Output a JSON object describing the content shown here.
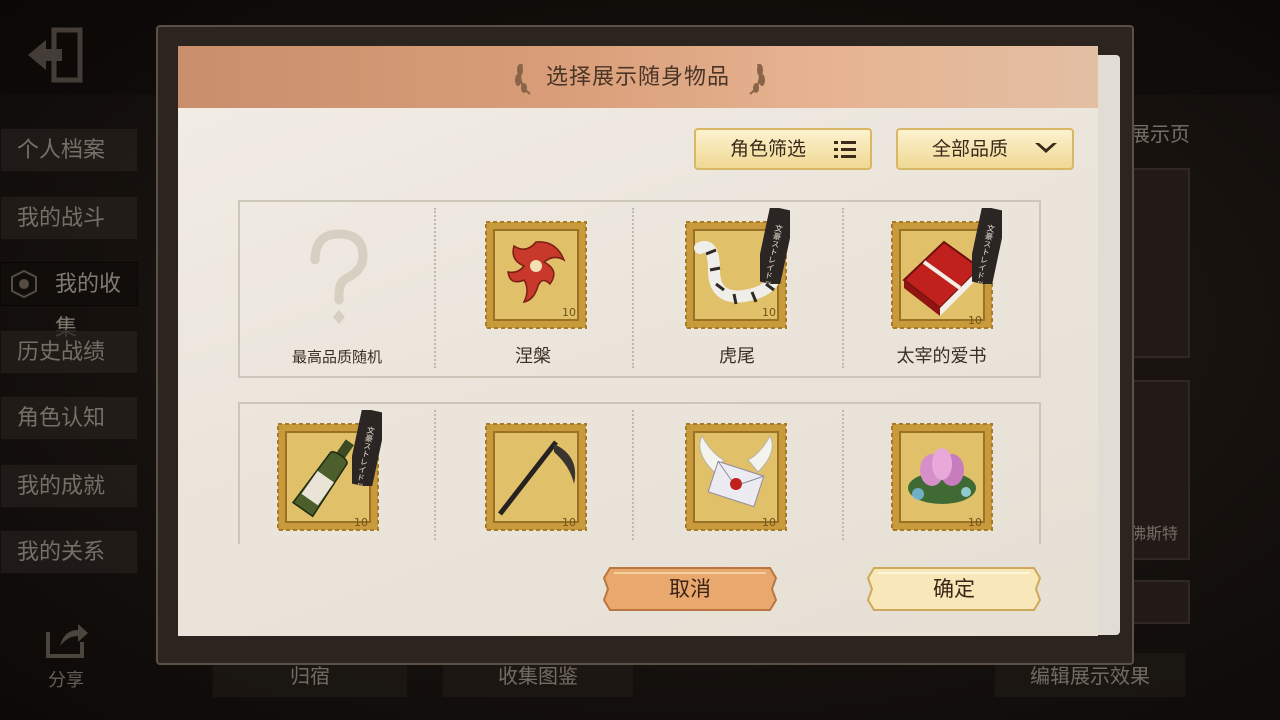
{
  "background": {
    "side_tabs": [
      "个人档案",
      "我的战斗",
      "我的收集",
      "历史战绩",
      "角色认知",
      "我的成就",
      "我的关系"
    ],
    "active_tab": "我的收集",
    "share_label": "分享",
    "bottom_left_label": "归宿",
    "bottom_mid_label": "收集图鉴",
    "bottom_right_label": "编辑展示效果",
    "right_title": "展示页",
    "right_labels": [
      "佛斯特"
    ]
  },
  "modal": {
    "title": "选择展示随身物品",
    "filter_role_label": "角色筛选",
    "filter_quality_label": "全部品质",
    "items": [
      {
        "label": "最高品质随机",
        "icon": "question-mark-icon"
      },
      {
        "label": "涅槃",
        "icon": "phoenix-icon"
      },
      {
        "label": "虎尾",
        "icon": "tiger-tail-icon"
      },
      {
        "label": "太宰的爱书",
        "icon": "red-book-icon"
      },
      {
        "label": "",
        "icon": "wine-bottle-icon"
      },
      {
        "label": "",
        "icon": "scythe-icon"
      },
      {
        "label": "",
        "icon": "winged-letter-icon"
      },
      {
        "label": "",
        "icon": "lotus-icon"
      }
    ],
    "stamp_value": "10",
    "collab_tag": "文豪ストレイドッグス",
    "cancel_label": "取消",
    "confirm_label": "确定"
  },
  "colors": {
    "header": "#d89d78",
    "stamp_gold": "#d9b25a",
    "button_gold": "#f0d995",
    "cancel_orange": "#e9a86e"
  }
}
